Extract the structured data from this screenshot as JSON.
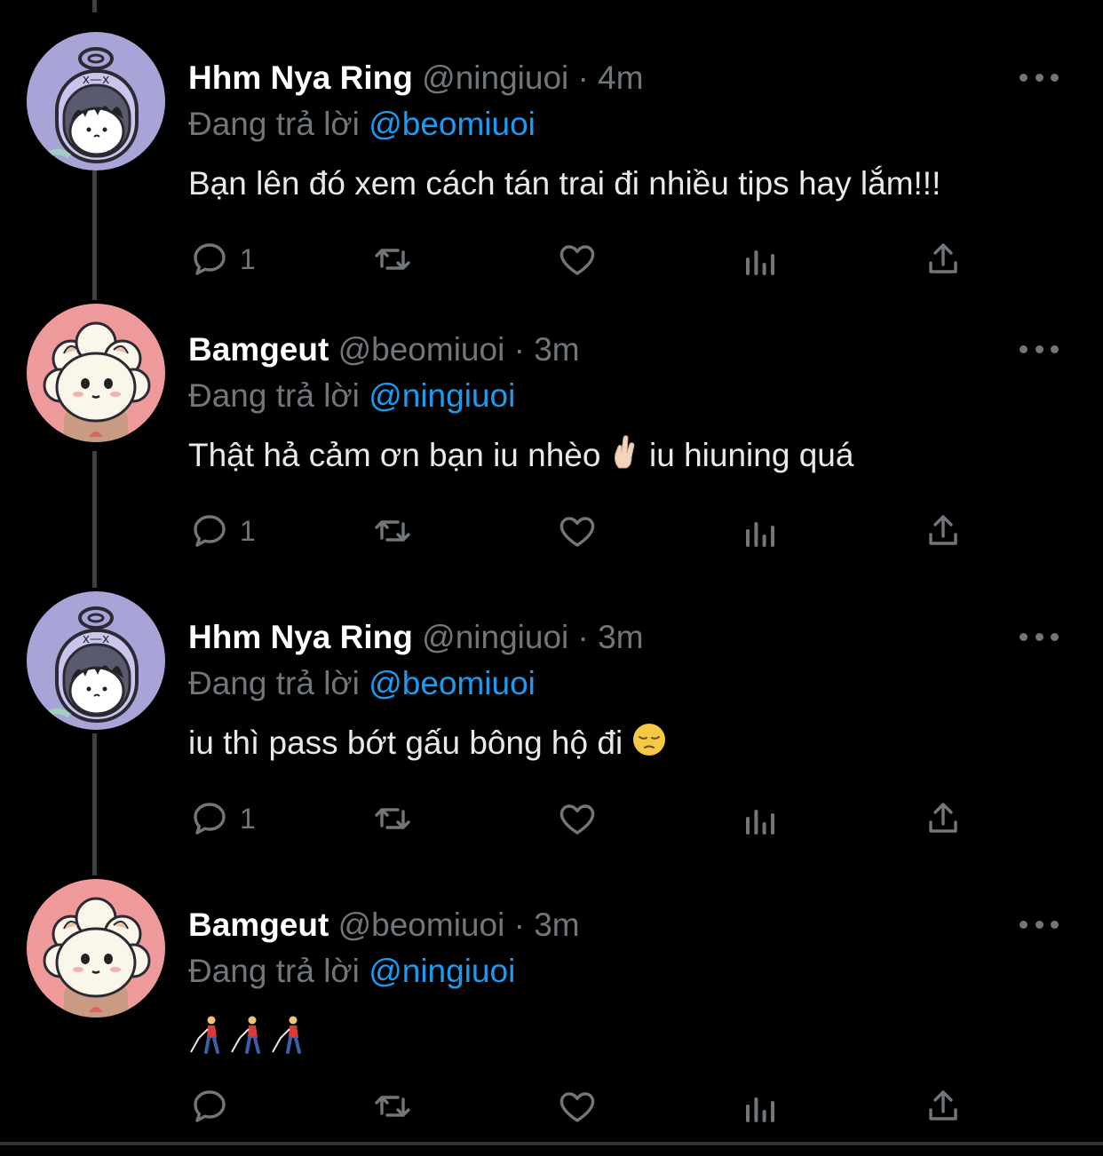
{
  "tweets": [
    {
      "name": "Hhm Nya Ring",
      "handle": "@ningiuoi",
      "dot": "·",
      "time": "4m",
      "reply_prefix": "Đang trả lời",
      "reply_to": "@beomiuoi",
      "text": "Bạn lên đó xem cách tán trai đi nhiều tips hay lắm!!!",
      "reply_count": "1",
      "avatar_icon": "astronaut-avatar-icon"
    },
    {
      "name": "Bamgeut",
      "handle": "@beomiuoi",
      "dot": "·",
      "time": "3m",
      "reply_prefix": "Đang trả lời",
      "reply_to": "@ningiuoi",
      "text_before_emoji": "Thật hả cảm ơn bạn iu nhèo",
      "emoji": "crossed-fingers-emoji",
      "text_after_emoji": "iu hiuning quá",
      "reply_count": "1",
      "avatar_icon": "sheep-avatar-icon"
    },
    {
      "name": "Hhm Nya Ring",
      "handle": "@ningiuoi",
      "dot": "·",
      "time": "3m",
      "reply_prefix": "Đang trả lời",
      "reply_to": "@beomiuoi",
      "text_before_emoji": "iu thì pass bớt gấu bông hộ đi",
      "emoji": "pensive-face-emoji",
      "reply_count": "1",
      "avatar_icon": "astronaut-avatar-icon"
    },
    {
      "name": "Bamgeut",
      "handle": "@beomiuoi",
      "dot": "·",
      "time": "3m",
      "reply_prefix": "Đang trả lời",
      "reply_to": "@ningiuoi",
      "emoji": "person-with-white-cane-emoji",
      "emoji_count": 3,
      "reply_count": "",
      "avatar_icon": "sheep-avatar-icon"
    }
  ],
  "colors": {
    "background": "#000000",
    "secondary_text": "#71767b",
    "mention": "#1d9bf0",
    "thread_line": "#3b4045",
    "astronaut_avatar_bg": "#a9a4d8",
    "sheep_avatar_bg": "#ee9a9a"
  },
  "action_icons": [
    "reply-icon",
    "retweet-icon",
    "like-icon",
    "views-icon",
    "share-icon"
  ]
}
